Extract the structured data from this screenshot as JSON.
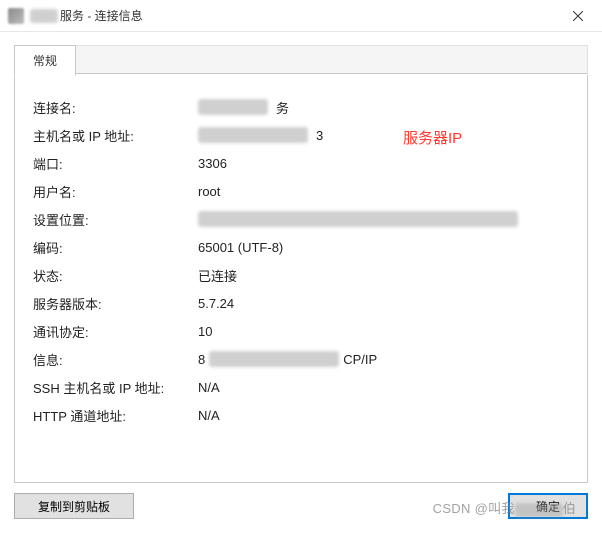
{
  "window": {
    "title_prefix": "",
    "title_obscured": "　　",
    "title_suffix": "服务 - 连接信息"
  },
  "tabs": {
    "general": "常规"
  },
  "fields": {
    "connection_name": {
      "label": "连接名:",
      "value": "　　　　　务"
    },
    "host": {
      "label": "主机名或 IP 地址:",
      "value": "　　　　　　3",
      "annotation": "服务器IP"
    },
    "port": {
      "label": "端口:",
      "value": "3306"
    },
    "username": {
      "label": "用户名:",
      "value": "root"
    },
    "settings_location": {
      "label": "设置位置:",
      "value": "　　　　　　　　　　　　　　　　　　"
    },
    "encoding": {
      "label": "编码:",
      "value": "65001 (UTF-8)"
    },
    "status": {
      "label": "状态:",
      "value": "已连接"
    },
    "server_version": {
      "label": "服务器版本:",
      "value": "5.7.24"
    },
    "protocol": {
      "label": "通讯协定:",
      "value": "10"
    },
    "info": {
      "label": "信息:",
      "value_prefix": "8",
      "value_suffix": "CP/IP"
    },
    "ssh_host": {
      "label": "SSH 主机名或 IP 地址:",
      "value": "N/A"
    },
    "http_tunnel": {
      "label": "HTTP 通道地址:",
      "value": "N/A"
    }
  },
  "buttons": {
    "copy": "复制到剪贴板",
    "ok": "确定"
  },
  "watermark": {
    "prefix": "CSDN @叫我",
    "suffix": "伯"
  }
}
